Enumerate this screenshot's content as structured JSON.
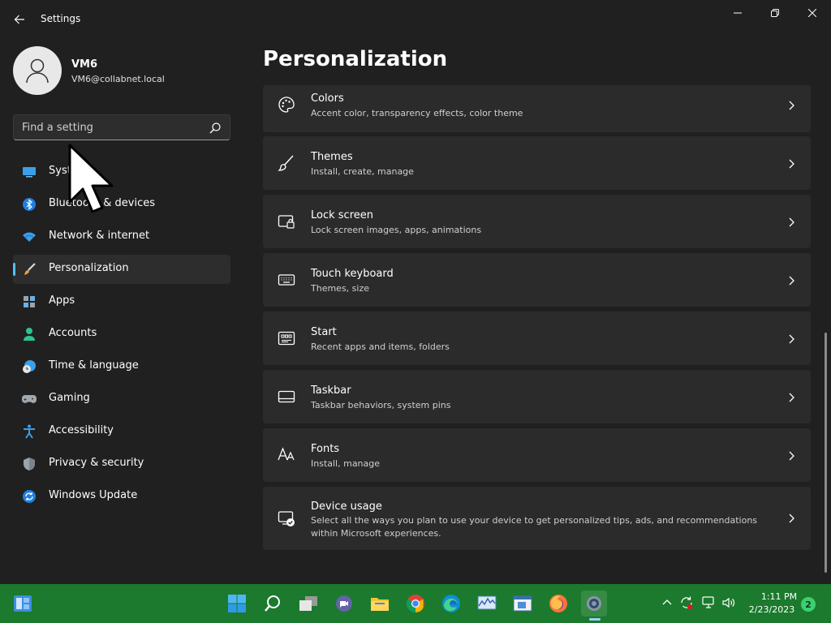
{
  "window": {
    "title": "Settings"
  },
  "profile": {
    "name": "VM6",
    "email": "VM6@collabnet.local"
  },
  "search": {
    "placeholder": "Find a setting"
  },
  "sidebar": {
    "items": [
      {
        "label": "System",
        "icon": "monitor-icon",
        "selected": false
      },
      {
        "label": "Bluetooth & devices",
        "icon": "bluetooth-icon",
        "selected": false
      },
      {
        "label": "Network & internet",
        "icon": "wifi-icon",
        "selected": false
      },
      {
        "label": "Personalization",
        "icon": "paintbrush-icon",
        "selected": true
      },
      {
        "label": "Apps",
        "icon": "apps-icon",
        "selected": false
      },
      {
        "label": "Accounts",
        "icon": "person-icon",
        "selected": false
      },
      {
        "label": "Time & language",
        "icon": "clock-globe-icon",
        "selected": false
      },
      {
        "label": "Gaming",
        "icon": "gamepad-icon",
        "selected": false
      },
      {
        "label": "Accessibility",
        "icon": "accessibility-icon",
        "selected": false
      },
      {
        "label": "Privacy & security",
        "icon": "shield-icon",
        "selected": false
      },
      {
        "label": "Windows Update",
        "icon": "update-icon",
        "selected": false
      }
    ]
  },
  "main": {
    "title": "Personalization",
    "cards": [
      {
        "title": "Colors",
        "desc": "Accent color, transparency effects, color theme",
        "icon": "palette-icon"
      },
      {
        "title": "Themes",
        "desc": "Install, create, manage",
        "icon": "brush-icon"
      },
      {
        "title": "Lock screen",
        "desc": "Lock screen images, apps, animations",
        "icon": "lock-screen-icon"
      },
      {
        "title": "Touch keyboard",
        "desc": "Themes, size",
        "icon": "keyboard-icon"
      },
      {
        "title": "Start",
        "desc": "Recent apps and items, folders",
        "icon": "start-icon"
      },
      {
        "title": "Taskbar",
        "desc": "Taskbar behaviors, system pins",
        "icon": "taskbar-icon"
      },
      {
        "title": "Fonts",
        "desc": "Install, manage",
        "icon": "fonts-icon"
      },
      {
        "title": "Device usage",
        "desc": "Select all the ways you plan to use your device to get personalized tips, ads, and recommendations within Microsoft experiences.",
        "icon": "device-usage-icon"
      }
    ]
  },
  "taskbar": {
    "time": "1:11 PM",
    "date": "2/23/2023",
    "notifications": "2",
    "color": "#1b7a2d"
  },
  "colors": {
    "accent": "#4cc2ff",
    "background": "#202020",
    "card": "#2b2b2b"
  }
}
